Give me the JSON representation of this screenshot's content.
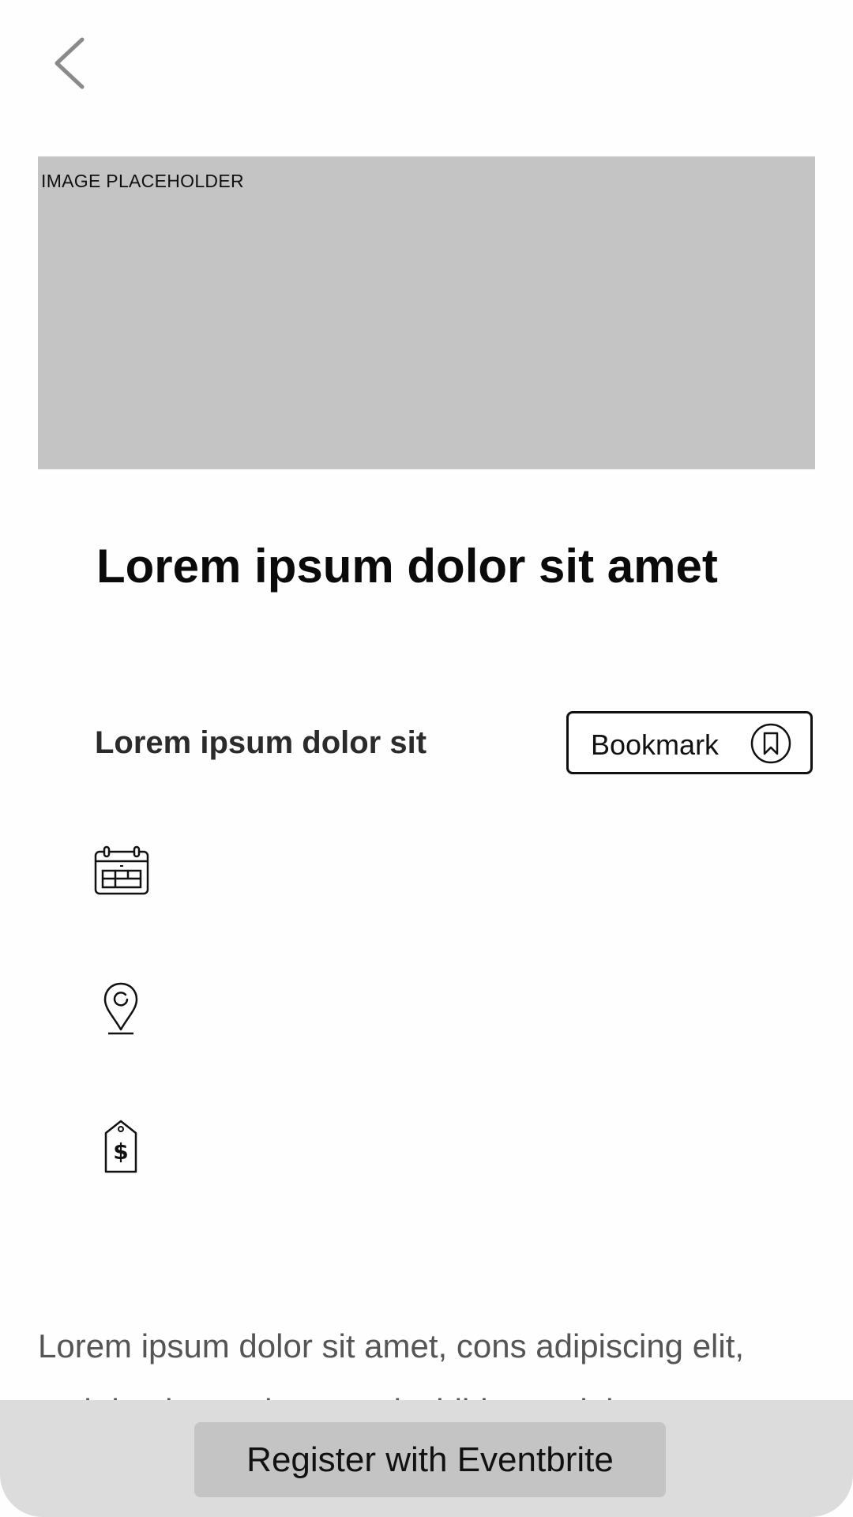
{
  "header": {
    "back_icon": "chevron-left-icon"
  },
  "hero": {
    "placeholder_label": "IMAGE PLACEHOLDER"
  },
  "event": {
    "title": "Lorem ipsum dolor sit amet",
    "subtitle": "Lorem ipsum dolor sit",
    "bookmark_label": "Bookmark",
    "bookmark_icon": "bookmark-icon",
    "info_icons": [
      "calendar-icon",
      "location-pin-icon",
      "price-tag-icon"
    ],
    "description_lines": [
      "Lorem ipsum dolor sit amet, cons adipiscing elit,",
      "sed do eiusmod tempor incididunt ut labore et"
    ]
  },
  "footer": {
    "register_label": "Register with Eventbrite"
  },
  "colors": {
    "placeholder_gray": "#c4c4c4",
    "footer_bar": "#dcdcdc",
    "text_dark": "#0a0a0a",
    "text_body": "#555555"
  }
}
